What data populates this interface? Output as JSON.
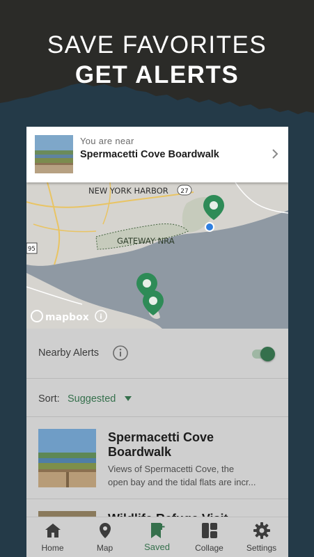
{
  "headline": {
    "line1": "SAVE FAVORITES",
    "line2": "GET ALERTS"
  },
  "nearby": {
    "subtitle": "You are near",
    "title": "Spermacetti Cove Boardwalk"
  },
  "map": {
    "labels": {
      "harbor": "NEW YORK HARBOR",
      "route27": "27",
      "park": "GATEWAY NRA",
      "route95": "95"
    },
    "attribution": "mapbox",
    "colors": {
      "water": "#8f99a3",
      "land": "#d6d4cf",
      "park": "#c6cbbc",
      "pin": "#2e8b57",
      "location": "#2f7fe0"
    }
  },
  "alerts": {
    "label": "Nearby Alerts",
    "enabled": true
  },
  "sort": {
    "label": "Sort:",
    "value": "Suggested"
  },
  "items": [
    {
      "title": "Spermacetti Cove Boardwalk",
      "desc_line1": "Views of Spermacetti Cove, the",
      "desc_line2": "open bay and the tidal flats are incr..."
    },
    {
      "title": "Wildlife Refuge Visit"
    }
  ],
  "tabs": [
    {
      "label": "Home",
      "icon": "home-icon"
    },
    {
      "label": "Map",
      "icon": "map-pin-icon"
    },
    {
      "label": "Saved",
      "icon": "bookmark-add-icon",
      "active": true
    },
    {
      "label": "Collage",
      "icon": "collage-icon"
    },
    {
      "label": "Settings",
      "icon": "gear-icon"
    }
  ],
  "accent": "#35704c"
}
